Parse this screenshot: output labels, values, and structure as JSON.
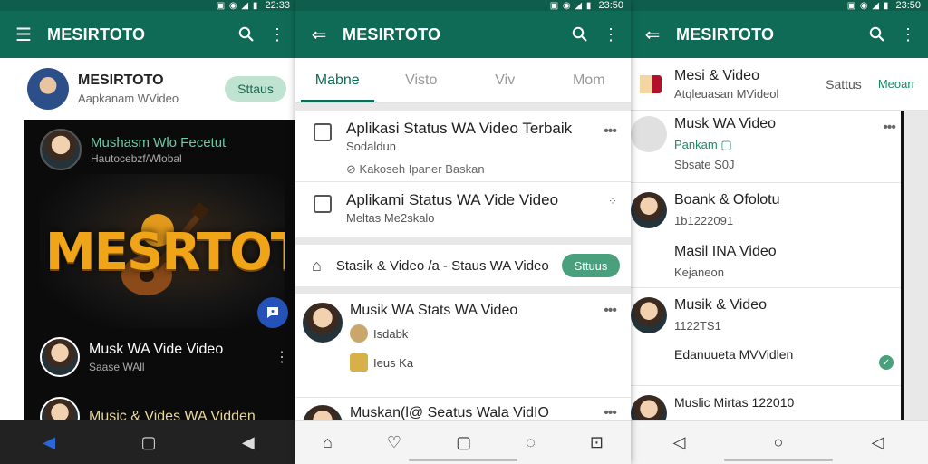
{
  "colors": {
    "appbar": "#0f6b55",
    "statusbar": "#0f5e4c",
    "accent": "#1b8a62",
    "button_soft": "#bfe3d0",
    "button_solid": "#4aa07d"
  },
  "p1": {
    "status_time": "22:33",
    "title": "MESIRTOTO",
    "profile": {
      "name": "MESIRTOTO",
      "sub": "Aapkanam WVideo",
      "button": "Sttaus"
    },
    "feed_head": {
      "name": "Mushasm Wlo Fecetut",
      "sub": "Hautocebzf/Wlobal"
    },
    "poster_text": "MESRTOTO",
    "rows": [
      {
        "title": "Musk WA Vide Video",
        "sub": "Saase WAll"
      },
      {
        "title": "Music & Vides WA Vidden",
        "sub": ""
      }
    ]
  },
  "p2": {
    "status_time": "23:50",
    "title": "MESIRTOTO",
    "tabs": [
      "Mabne",
      "Visto",
      "Viv",
      "Mom"
    ],
    "items": [
      {
        "title": "Aplikasi Status WA Video Terbaik",
        "sub": "Sodaldun",
        "sub2": "Kakoseh Ipaner Baskan"
      },
      {
        "title": "Aplikami Status WA Vide Video",
        "sub": "Meltas Me2skalo"
      }
    ],
    "share": {
      "text": "Stasik & Video /a - Staus WA Video",
      "button": "Sttuus"
    },
    "contacts": [
      {
        "title": "Musik WA Stats WA Video",
        "sub": "Isdabk",
        "sub2": "Ieus Ka"
      },
      {
        "title": "Muskan(l@ Seatus Wala VidIO",
        "sub": ""
      }
    ]
  },
  "p3": {
    "status_time": "23:50",
    "title": "MESIRTOTO",
    "top": {
      "title": "Mesi & Video",
      "sub": "Atqleuasan MVideol",
      "tab1": "Sattus",
      "tab2": "Meoarr"
    },
    "rows": [
      {
        "title": "Musk WA Video",
        "sub": "Pankam",
        "extra": "Sbsate S0J"
      },
      {
        "title": "Boank & Ofolotu",
        "sub": "1b1222091",
        "title2": "Masil INA Video",
        "sub2": "Kejaneon"
      },
      {
        "title": "Musik & Video",
        "sub": "1122TS1",
        "title2": "Edanuueta MVVidlen"
      },
      {
        "title": "Muslic Mirtas 122010",
        "sub": ""
      }
    ]
  }
}
